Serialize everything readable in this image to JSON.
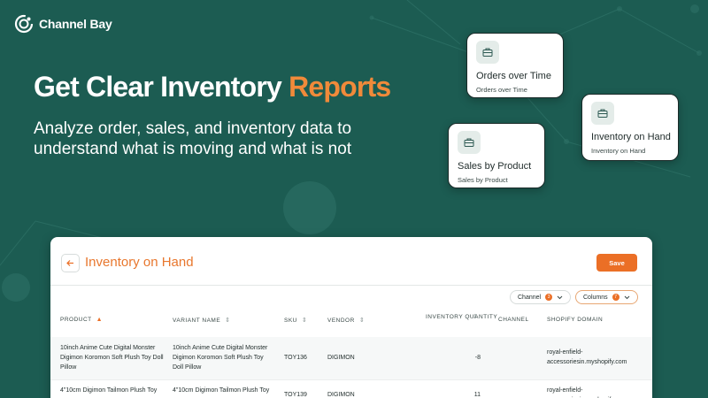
{
  "brand": {
    "name": "Channel Bay"
  },
  "hero": {
    "title_main": "Get Clear Inventory ",
    "title_accent": "Reports",
    "subtitle": "Analyze order, sales, and inventory data to understand what is moving and what is not"
  },
  "report_cards": [
    {
      "title": "Orders over Time",
      "subtitle": "Orders over Time"
    },
    {
      "title": "Inventory on Hand",
      "subtitle": "Inventory on Hand"
    },
    {
      "title": "Sales by Product",
      "subtitle": "Sales by Product"
    }
  ],
  "panel": {
    "title": "Inventory on Hand",
    "save_label": "Save",
    "filters": [
      {
        "label": "Channel",
        "count": "3"
      },
      {
        "label": "Columns",
        "count": "7"
      }
    ],
    "columns": [
      "PRODUCT",
      "VARIANT NAME",
      "SKU",
      "VENDOR",
      "INVENTORY QUANTITY",
      "CHANNEL",
      "SHOPIFY DOMAIN"
    ],
    "rows": [
      {
        "product": "10inch Anime Cute Digital Monster Digimon Koromon Soft Plush Toy Doll Pillow",
        "variant": "10inch Anime Cute Digital Monster Digimon Koromon Soft Plush Toy Doll Pillow",
        "sku": "TOY136",
        "vendor": "DIGIMON",
        "quantity": "-8",
        "channel": "",
        "domain": "royal-enfield-accessoriesin.myshopify.com"
      },
      {
        "product": "4\"10cm Digimon Tailmon Plush Toy",
        "variant": "4\"10cm Digimon Tailmon Plush Toy",
        "sku": "TOY139",
        "vendor": "DIGIMON",
        "quantity": "11",
        "channel": "",
        "domain": "royal-enfield-accessoriesin.myshopify.com"
      }
    ]
  },
  "colors": {
    "background": "#1c5c52",
    "accent": "#eb6f26",
    "title_accent": "#f08a3a"
  },
  "icons": [
    "channel-bay-logo-icon",
    "briefcase-icon",
    "arrow-left-icon",
    "chevron-down-icon",
    "sort-icon"
  ]
}
